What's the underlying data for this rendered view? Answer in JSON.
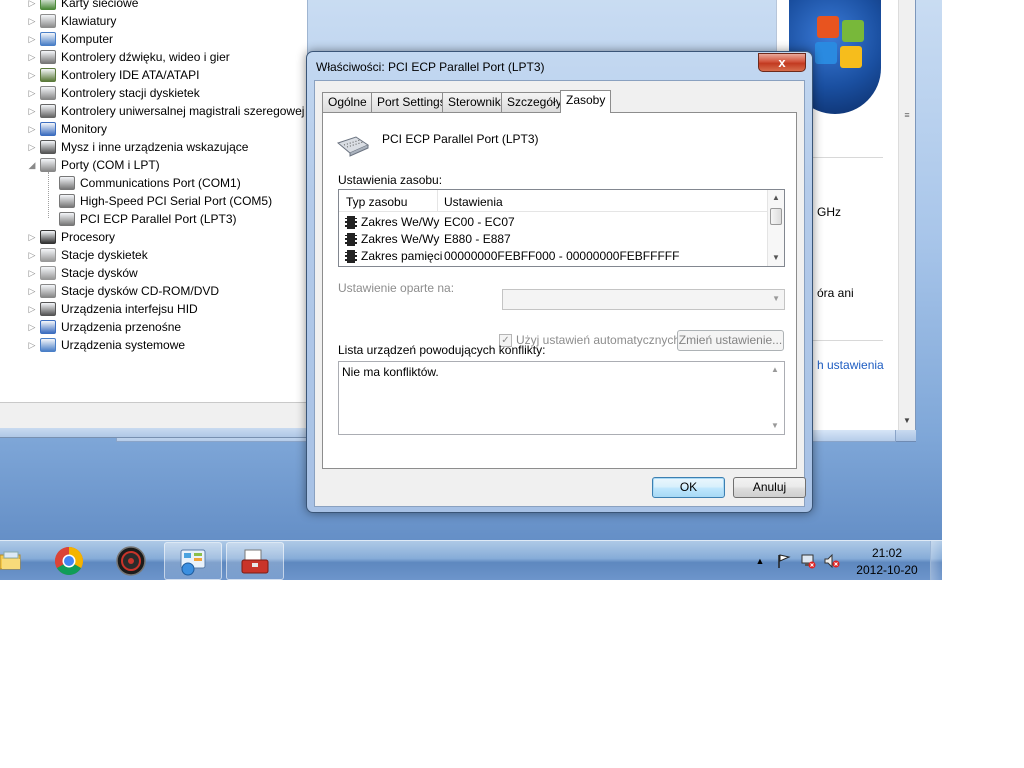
{
  "device_manager": {
    "items": [
      {
        "label": "Karty sieciowe",
        "icon": "network-adapter-icon",
        "expanded": false
      },
      {
        "label": "Klawiatury",
        "icon": "keyboard-icon",
        "expanded": false
      },
      {
        "label": "Komputer",
        "icon": "computer-icon",
        "expanded": false
      },
      {
        "label": "Kontrolery dźwięku, wideo i gier",
        "icon": "speaker-icon",
        "expanded": false
      },
      {
        "label": "Kontrolery IDE ATA/ATAPI",
        "icon": "ide-controller-icon",
        "expanded": false
      },
      {
        "label": "Kontrolery stacji dyskietek",
        "icon": "floppy-controller-icon",
        "expanded": false
      },
      {
        "label": "Kontrolery uniwersalnej magistrali szeregowej",
        "icon": "usb-icon",
        "expanded": false
      },
      {
        "label": "Monitory",
        "icon": "monitor-icon",
        "expanded": false
      },
      {
        "label": "Mysz i inne urządzenia wskazujące",
        "icon": "mouse-icon",
        "expanded": false
      },
      {
        "label": "Porty (COM i LPT)",
        "icon": "port-icon",
        "expanded": true
      },
      {
        "label": "Procesory",
        "icon": "processor-icon",
        "expanded": false
      },
      {
        "label": "Stacje dyskietek",
        "icon": "floppy-drive-icon",
        "expanded": false
      },
      {
        "label": "Stacje dysków",
        "icon": "disk-drive-icon",
        "expanded": false
      },
      {
        "label": "Stacje dysków CD-ROM/DVD",
        "icon": "cdrom-icon",
        "expanded": false
      },
      {
        "label": "Urządzenia interfejsu HID",
        "icon": "hid-icon",
        "expanded": false
      },
      {
        "label": "Urządzenia przenośne",
        "icon": "portable-device-icon",
        "expanded": false
      },
      {
        "label": "Urządzenia systemowe",
        "icon": "system-device-icon",
        "expanded": false
      }
    ],
    "ports_children": [
      {
        "label": "Communications Port (COM1)"
      },
      {
        "label": "High-Speed PCI Serial Port (COM5)"
      },
      {
        "label": "PCI ECP Parallel Port (LPT3)"
      }
    ]
  },
  "right_window": {
    "ghz_text": "GHz",
    "ora_text": "óra ani",
    "link_text": "h ustawienia"
  },
  "dialog": {
    "title": "Właściwości: PCI ECP Parallel Port (LPT3)",
    "close_label": "x",
    "tabs": [
      {
        "label": "Ogólne",
        "active": false
      },
      {
        "label": "Port Settings",
        "active": false
      },
      {
        "label": "Sterownik",
        "active": false
      },
      {
        "label": "Szczegóły",
        "active": false
      },
      {
        "label": "Zasoby",
        "active": true
      }
    ],
    "device_name": "PCI ECP Parallel Port (LPT3)",
    "resources_label": "Ustawienia zasobu:",
    "resources_columns": [
      "Typ zasobu",
      "Ustawienia"
    ],
    "resources_rows": [
      {
        "type": "Zakres We/Wy",
        "setting": "EC00 - EC07"
      },
      {
        "type": "Zakres We/Wy",
        "setting": "E880 - E887"
      },
      {
        "type": "Zakres pamięci",
        "setting": "00000000FEBFF000 - 00000000FEBFFFFF"
      }
    ],
    "based_on_label": "Ustawienie oparte na:",
    "based_on_value": "",
    "auto_settings_label": "Użyj ustawień automatycznych",
    "auto_settings_checked": true,
    "change_settings_label": "Zmień ustawienie...",
    "conflicts_label": "Lista urządzeń powodujących konflikty:",
    "conflicts_text": "Nie ma konfliktów.",
    "ok_label": "OK",
    "cancel_label": "Anuluj"
  },
  "taskbar": {
    "buttons": [
      {
        "name": "explorer",
        "icon": "folder-icon",
        "open": false
      },
      {
        "name": "chrome",
        "icon": "chrome-icon",
        "open": false
      },
      {
        "name": "app",
        "icon": "round-app-icon",
        "open": false
      },
      {
        "name": "control-panel",
        "icon": "control-panel-icon",
        "open": true
      },
      {
        "name": "device-manager",
        "icon": "toolbox-icon",
        "open": true
      }
    ],
    "clock_time": "21:02",
    "clock_date": "2012-10-20"
  },
  "colors": {
    "accent": "#3c7fb1",
    "taskbar": "#6d95cb",
    "close_button": "#c23a20",
    "disabled_text": "#8d8d8d"
  }
}
